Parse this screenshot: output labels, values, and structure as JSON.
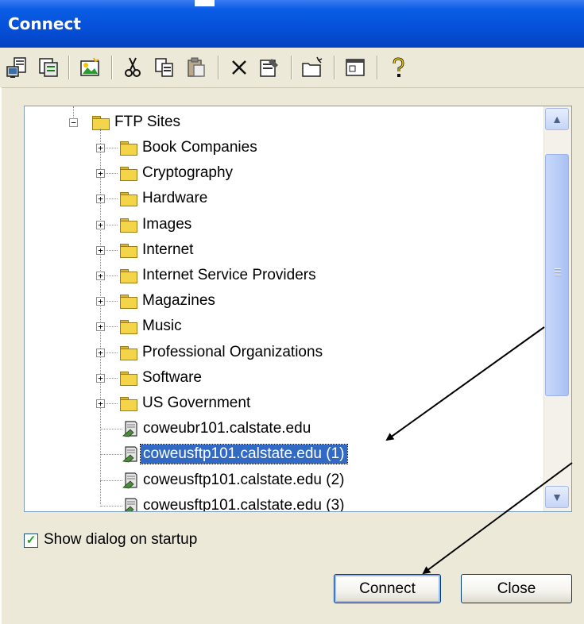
{
  "window": {
    "title": "Connect"
  },
  "toolbar": {
    "buttons": [
      {
        "icon": "connect-icon"
      },
      {
        "icon": "quick-connect-icon"
      },
      {
        "icon": "new-site-icon"
      },
      {
        "icon": "cut-icon"
      },
      {
        "icon": "copy-icon"
      },
      {
        "icon": "paste-icon"
      },
      {
        "icon": "delete-icon"
      },
      {
        "icon": "properties-icon"
      },
      {
        "icon": "new-folder-icon"
      },
      {
        "icon": "window-icon"
      },
      {
        "icon": "help-icon"
      }
    ]
  },
  "tree": {
    "root": {
      "label": "FTP Sites",
      "toggle": "−"
    },
    "folders": [
      "Book Companies",
      "Cryptography",
      "Hardware",
      "Images",
      "Internet",
      "Internet Service Providers",
      "Magazines",
      "Music",
      "Professional Organizations",
      "Software",
      "US Government"
    ],
    "folder_toggle": "+",
    "sites": [
      {
        "label": "coweubr101.calstate.edu",
        "selected": false
      },
      {
        "label": "coweusftp101.calstate.edu (1)",
        "selected": true
      },
      {
        "label": "coweusftp101.calstate.edu (2)",
        "selected": false
      },
      {
        "label": "coweusftp101.calstate.edu (3)",
        "selected": false
      }
    ]
  },
  "scrollbar": {
    "up_glyph": "▲",
    "down_glyph": "▼"
  },
  "options": {
    "show_dialog_label": "Show dialog on startup",
    "show_dialog_checked": true,
    "check_glyph": "✓"
  },
  "buttons": {
    "connect": "Connect",
    "close": "Close"
  },
  "colors": {
    "titlebar": "#0550d8",
    "selection": "#316ac5",
    "dialog_bg": "#ece9d8",
    "folder": "#f4d54a"
  }
}
